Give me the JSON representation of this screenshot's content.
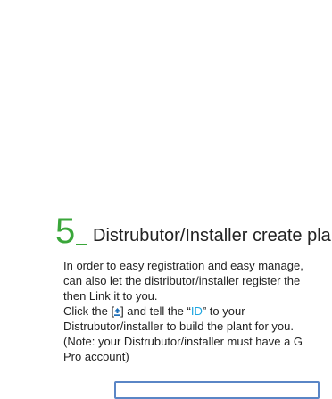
{
  "step": {
    "number": "5",
    "title": "Distrubutor/Installer create pla"
  },
  "paragraph": {
    "line1": "In order to easy registration and easy manage,",
    "line2": "can also let the distributor/installer register the",
    "line3": "then Link it to you.",
    "line4_before": "Click the [",
    "line4_after": "] and tell the “",
    "id_word": "ID",
    "line4_end": "”  to your",
    "line5": "Distrubutor/installer to build the plant for you.",
    "line6": "(Note: your Distrubutor/installer must have a G",
    "line7": "Pro account)"
  },
  "icons": {
    "link_icon": "person-upload-icon"
  },
  "colors": {
    "step_number": "#3aa63a",
    "id_highlight": "#1ea5e0",
    "frame_border": "#5a86c6"
  }
}
